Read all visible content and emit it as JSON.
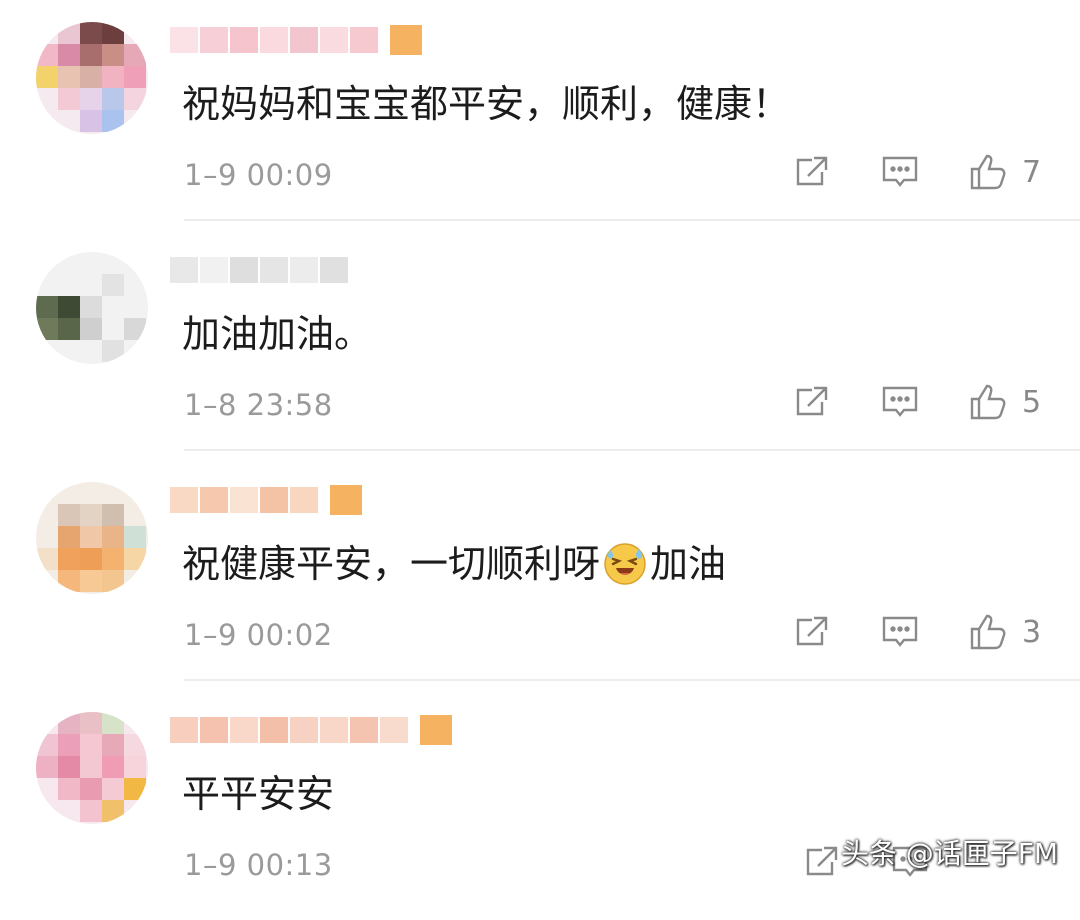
{
  "comments": [
    {
      "text": "祝妈妈和宝宝都平安，顺利，健康！",
      "emoji": "",
      "text_after": "",
      "time": "1–9 00:09",
      "likes": "7"
    },
    {
      "text": "加油加油。",
      "emoji": "",
      "text_after": "",
      "time": "1–8 23:58",
      "likes": "5"
    },
    {
      "text": "祝健康平安，一切顺利呀",
      "emoji": "laughing-tears-emoji",
      "text_after": "加油",
      "time": "1–9 00:02",
      "likes": "3"
    },
    {
      "text": "平平安安",
      "emoji": "",
      "text_after": "",
      "time": "1–9 00:13",
      "likes": ""
    }
  ],
  "icons": {
    "share": "share-icon",
    "reply": "comment-icon",
    "like": "thumbs-up-icon"
  },
  "colors": {
    "text": "#1c1c1c",
    "timestamp": "#9a9a9a",
    "divider": "#ececec",
    "badge": "#f3a646"
  },
  "watermark": "头条 @话匣子FM"
}
